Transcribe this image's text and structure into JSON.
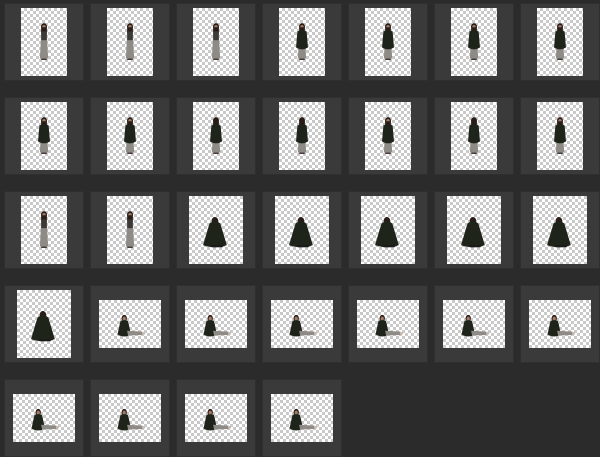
{
  "grid": {
    "rows": [
      7,
      7,
      7,
      7,
      4
    ],
    "colors": {
      "background": "#2b2b2b",
      "cell": "#3a3a3a",
      "checker_light": "#ffffff",
      "checker_dark": "#c9c9c9"
    }
  },
  "frames": [
    {
      "pose": "standing-front",
      "shawl": false
    },
    {
      "pose": "standing-front",
      "shawl": false
    },
    {
      "pose": "standing-front",
      "shawl": false
    },
    {
      "pose": "standing-front",
      "shawl": true
    },
    {
      "pose": "standing-front",
      "shawl": true
    },
    {
      "pose": "standing-front",
      "shawl": true
    },
    {
      "pose": "standing-front",
      "shawl": true
    },
    {
      "pose": "standing-front",
      "shawl": true
    },
    {
      "pose": "standing-front",
      "shawl": true
    },
    {
      "pose": "standing-back",
      "shawl": true
    },
    {
      "pose": "standing-back",
      "shawl": true
    },
    {
      "pose": "standing-side",
      "shawl": true
    },
    {
      "pose": "standing-back",
      "shawl": true
    },
    {
      "pose": "standing-side",
      "shawl": true
    },
    {
      "pose": "standing-side",
      "shawl": false
    },
    {
      "pose": "standing-side",
      "shawl": false
    },
    {
      "pose": "crouching",
      "shawl": true
    },
    {
      "pose": "crouching",
      "shawl": true
    },
    {
      "pose": "crouching",
      "shawl": true
    },
    {
      "pose": "crouching",
      "shawl": true
    },
    {
      "pose": "crouching",
      "shawl": true
    },
    {
      "pose": "crouching",
      "shawl": true
    },
    {
      "pose": "seated",
      "shawl": true
    },
    {
      "pose": "seated",
      "shawl": true
    },
    {
      "pose": "seated",
      "shawl": true
    },
    {
      "pose": "seated",
      "shawl": true
    },
    {
      "pose": "seated",
      "shawl": true
    },
    {
      "pose": "seated",
      "shawl": true
    },
    {
      "pose": "seated",
      "shawl": true
    },
    {
      "pose": "seated",
      "shawl": true
    },
    {
      "pose": "seated",
      "shawl": true
    },
    {
      "pose": "seated",
      "shawl": true
    }
  ]
}
